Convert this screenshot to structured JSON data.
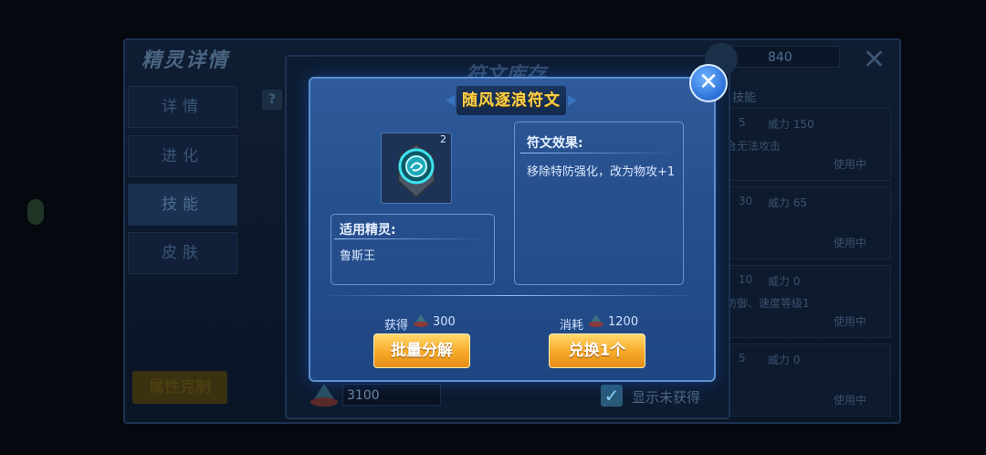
{
  "background": {
    "panel_title": "精灵详情",
    "tabs": [
      {
        "label": "详情"
      },
      {
        "label": "进化"
      },
      {
        "label": "技能"
      },
      {
        "label": "皮肤"
      }
    ],
    "attr_button": "属性克制",
    "inner_title": "符文库存",
    "currency_value": "3100",
    "show_unobtained_label": "显示未获得",
    "top_value": "840",
    "question": "?",
    "skill_header": "技能",
    "skills": [
      {
        "pp": "5",
        "power": "威力 150",
        "desc": "合无法攻击",
        "status": "使用中"
      },
      {
        "pp": "30",
        "power": "威力 65",
        "desc": "",
        "status": "使用中"
      },
      {
        "pp": "10",
        "power": "威力 0",
        "desc": "防御、速度等级1",
        "status": "使用中"
      },
      {
        "pp": "5",
        "power": "威力 0",
        "desc": "",
        "status": "使用中"
      }
    ]
  },
  "dialog": {
    "title": "随风逐浪符文",
    "rune_count": "2",
    "effect_title": "符文效果:",
    "effect_text": "移除特防强化，改为物攻+1",
    "target_title": "适用精灵:",
    "target_text": "鲁斯王",
    "gain_label": "获得",
    "gain_value": "300",
    "cost_label": "消耗",
    "cost_value": "1200",
    "decompose_button": "批量分解",
    "exchange_button": "兑换1个",
    "close": "✕"
  },
  "colors": {
    "dialog_bg": "#27508e",
    "title_gold": "#ffd24a",
    "button_orange": "#f7a928"
  }
}
